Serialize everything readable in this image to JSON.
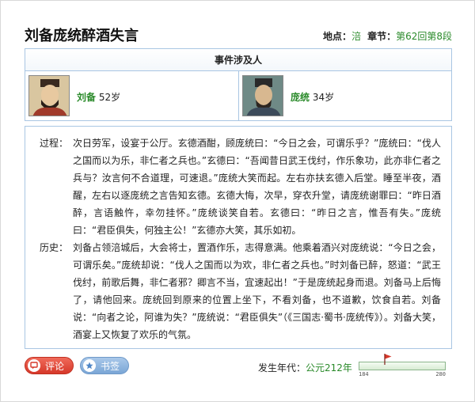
{
  "event": {
    "title": "刘备庞统醉酒失言",
    "location_label": "地点：",
    "location": "涪",
    "chapter_label": "章节：",
    "chapter": "第62回第8段"
  },
  "people": {
    "heading": "事件涉及人",
    "list": [
      {
        "name": "刘备",
        "age": "52岁"
      },
      {
        "name": "庞统",
        "age": "34岁"
      }
    ]
  },
  "sections": {
    "process_label": "过程：",
    "process_text": "次日劳军，设宴于公厅。玄德酒酣，顾庞统曰：“今日之会，可谓乐乎？”庞统曰：“伐人之国而以为乐，非仁者之兵也。”玄德曰：“吾闻昔日武王伐纣，作乐象功，此亦非仁者之兵与？汝言何不合道理，可速退。”庞统大笑而起。左右亦扶玄德入后堂。睡至半夜，酒醒，左右以逐庞统之言告知玄德。玄德大悔，次早，穿衣升堂，请庞统谢罪曰：“昨日酒醉，言语触忤，幸勿挂怀。”庞统谈笑自若。玄德曰：“昨日之言，惟吾有失。”庞统曰：“君臣俱失，何独主公！”玄德亦大笑，其乐如初。",
    "history_label": "历史：",
    "history_text": "刘备占领涪城后，大会将士，置酒作乐，志得意满。他乘着酒兴对庞统说：“今日之会，可谓乐矣。”庞统却说：“伐人之国而以为欢，非仁者之兵也。”时刘备已醉，怒道：“武王伐纣，前歌后舞，非仁者邪？卿言不当，宜速起出！”于是庞统起身而退。刘备马上后悔了，请他回来。庞统回到原来的位置上坐下，不看刘备，也不道歉，饮食自若。刘备说：“向者之论，阿谁为失？”庞统说：“君臣俱失”（《三国志·蜀书·庞统传》）。刘备大笑，酒宴上又恢复了欢乐的气氛。"
  },
  "footer": {
    "comment_label": "评论",
    "bookmark_label": "书签",
    "year_label": "发生年代：",
    "year_value": "公元212年",
    "timeline_min": "184",
    "timeline_max": "280",
    "timeline_position": 0.29
  },
  "colors": {
    "accent_green": "#2a8a2a",
    "border_blue": "#a9c6e3",
    "comment_red": "#d6382a",
    "bookmark_blue": "#7aa6d6"
  },
  "icons": {
    "comment": "comment-icon",
    "bookmark": "bookmark-icon",
    "flag": "flag-icon"
  }
}
